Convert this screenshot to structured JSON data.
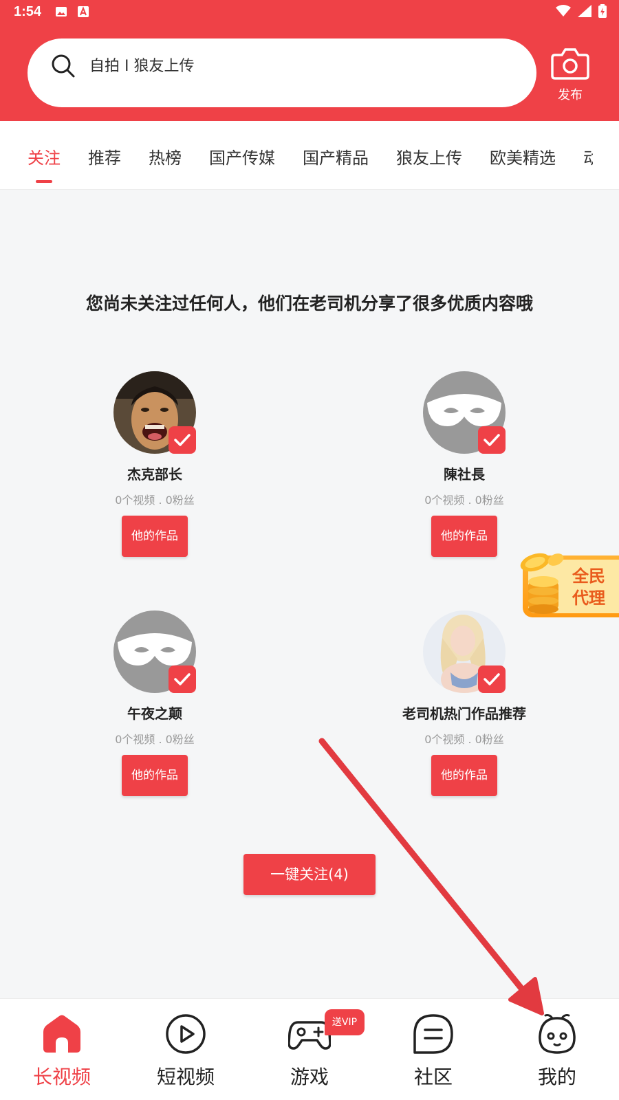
{
  "status": {
    "time": "1:54"
  },
  "search": {
    "text": "自拍 I 狼友上传",
    "icon": "search-icon"
  },
  "publish": {
    "label": "发布",
    "icon": "camera-icon"
  },
  "tabs": [
    {
      "label": "关注",
      "active": true
    },
    {
      "label": "推荐",
      "active": false
    },
    {
      "label": "热榜",
      "active": false
    },
    {
      "label": "国产传媒",
      "active": false
    },
    {
      "label": "国产精品",
      "active": false
    },
    {
      "label": "狼友上传",
      "active": false
    },
    {
      "label": "欧美精选",
      "active": false
    },
    {
      "label": "动",
      "active": false
    }
  ],
  "main": {
    "prompt": "您尚未关注过任何人，他们在老司机分享了很多优质内容哦",
    "users": [
      {
        "name": "杰克部长",
        "stats": "0个视频 . 0粉丝",
        "button": "他的作品",
        "checked": true
      },
      {
        "name": "陳社長",
        "stats": "0个视频 . 0粉丝",
        "button": "他的作品",
        "checked": true
      },
      {
        "name": "午夜之颠",
        "stats": "0个视频 . 0粉丝",
        "button": "他的作品",
        "checked": true
      },
      {
        "name": "老司机热门作品推荐",
        "stats": "0个视频 . 0粉丝",
        "button": "他的作品",
        "checked": true
      }
    ],
    "follow_all": "一键关注(4)"
  },
  "agent_badge": {
    "line1": "全民",
    "line2": "代理"
  },
  "bottom_nav": [
    {
      "label": "长视频",
      "icon": "home-icon",
      "active": true
    },
    {
      "label": "短视频",
      "icon": "play-icon",
      "active": false
    },
    {
      "label": "游戏",
      "icon": "gamepad-icon",
      "active": false,
      "badge": "送VIP"
    },
    {
      "label": "社区",
      "icon": "chat-icon",
      "active": false
    },
    {
      "label": "我的",
      "icon": "profile-icon",
      "active": false
    }
  ],
  "colors": {
    "brand": "#ef4147",
    "background": "#f5f6f7",
    "muted": "#999999"
  }
}
